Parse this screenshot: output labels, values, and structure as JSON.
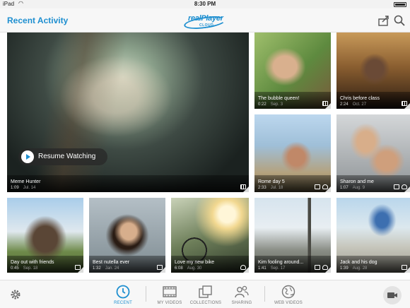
{
  "status_bar": {
    "carrier": "iPad",
    "time": "8:30 PM"
  },
  "header": {
    "title": "Recent Activity",
    "logo": {
      "brand": "realPlayer",
      "sub": "CLOUD"
    },
    "icons": [
      "share-icon",
      "search-icon"
    ]
  },
  "featured": {
    "title": "Meme Hunter",
    "duration": "1:09",
    "date": "Jul. 14",
    "resume_label": "Resume Watching"
  },
  "videos": [
    {
      "title": "The bubble queen!",
      "duration": "0:22",
      "date": "Sep. 3"
    },
    {
      "title": "Chris before class",
      "duration": "2:24",
      "date": "Oct. 27"
    },
    {
      "title": "Rome day 5",
      "duration": "2:33",
      "date": "Jul. 18"
    },
    {
      "title": "Sharon and me",
      "duration": "1:07",
      "date": "Aug. 9"
    },
    {
      "title": "Day out with friends",
      "duration": "0:45",
      "date": "Sep. 18"
    },
    {
      "title": "Best nutella ever",
      "duration": "1:32",
      "date": "Jan. 24"
    },
    {
      "title": "Love my new bike",
      "duration": "6:08",
      "date": "Aug. 30"
    },
    {
      "title": "Kim fooling around...",
      "duration": "1:41",
      "date": "Sep. 17"
    },
    {
      "title": "Jack and his dog",
      "duration": "1:39",
      "date": "Aug. 28"
    }
  ],
  "tabs": [
    {
      "label": "RECENT",
      "icon": "clock-icon",
      "active": true
    },
    {
      "label": "MY VIDEOS",
      "icon": "film-icon",
      "active": false
    },
    {
      "label": "COLLECTIONS",
      "icon": "collections-icon",
      "active": false
    },
    {
      "label": "SHARING",
      "icon": "people-icon",
      "active": false
    },
    {
      "label": "WEB VIDEOS",
      "icon": "globe-icon",
      "active": false
    }
  ],
  "colors": {
    "accent": "#1e8fd0",
    "tab_inactive": "#777777"
  }
}
